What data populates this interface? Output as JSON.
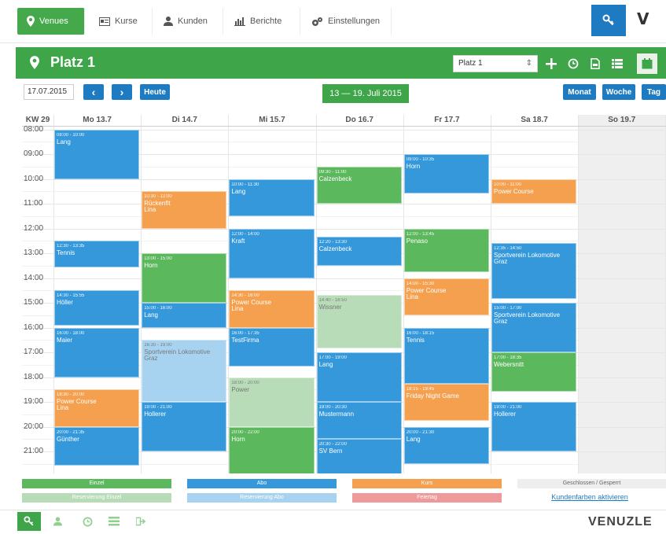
{
  "nav": {
    "tabs": [
      {
        "label": "Venues",
        "icon": "map-pin-icon"
      },
      {
        "label": "Kurse",
        "icon": "id-card-icon"
      },
      {
        "label": "Kunden",
        "icon": "person-icon"
      },
      {
        "label": "Berichte",
        "icon": "bar-chart-icon"
      },
      {
        "label": "Einstellungen",
        "icon": "gears-icon"
      }
    ],
    "logo_letter": "V"
  },
  "header": {
    "title": "Platz 1",
    "select_value": "Platz 1"
  },
  "toolbar": {
    "date_value": "17.07.2015",
    "prev": "‹",
    "next": "›",
    "today": "Heute",
    "range": "13 — 19. Juli 2015",
    "month": "Monat",
    "week": "Woche",
    "day": "Tag"
  },
  "calendar": {
    "week_label": "KW 29",
    "days": [
      "Mo 13.7",
      "Di 14.7",
      "Mi 15.7",
      "Do 16.7",
      "Fr 17.7",
      "Sa 18.7",
      "So 19.7"
    ],
    "hours": [
      "08:00",
      "09:00",
      "10:00",
      "11:00",
      "12:00",
      "13:00",
      "14:00",
      "15:00",
      "16:00",
      "17:00",
      "18:00",
      "19:00",
      "20:00",
      "21:00"
    ],
    "events": [
      {
        "day": 0,
        "start": 8.0,
        "end": 10.0,
        "time": "08:00 - 10:00",
        "name": "Lang",
        "type": "abo"
      },
      {
        "day": 0,
        "start": 12.5,
        "end": 13.58,
        "time": "12:30 - 13:35",
        "name": "Tennis",
        "type": "abo"
      },
      {
        "day": 0,
        "start": 14.5,
        "end": 15.92,
        "time": "14:30 - 15:55",
        "name": "Höller",
        "type": "abo"
      },
      {
        "day": 0,
        "start": 16.0,
        "end": 18.0,
        "time": "16:00 - 18:00",
        "name": "Maier",
        "type": "abo"
      },
      {
        "day": 0,
        "start": 18.5,
        "end": 20.0,
        "time": "18:30 - 20:00",
        "name": "Power Course",
        "sub": "Lina",
        "type": "kurs"
      },
      {
        "day": 0,
        "start": 20.0,
        "end": 21.58,
        "time": "20:00 - 21:35",
        "name": "Günther",
        "type": "abo"
      },
      {
        "day": 1,
        "start": 10.5,
        "end": 12.0,
        "time": "10:30 - 12:00",
        "name": "Rückenfit",
        "sub": "Lina",
        "type": "kurs"
      },
      {
        "day": 1,
        "start": 13.0,
        "end": 15.0,
        "time": "13:00 - 15:00",
        "name": "Horn",
        "type": "einzel"
      },
      {
        "day": 1,
        "start": 15.0,
        "end": 16.0,
        "time": "15:00 - 16:00",
        "name": "Lang",
        "type": "abo"
      },
      {
        "day": 1,
        "start": 16.5,
        "end": 19.0,
        "time": "16:30 - 19:00",
        "name": "Sportverein Lokomotive",
        "sub": "Graz",
        "type": "abo-res"
      },
      {
        "day": 1,
        "start": 19.0,
        "end": 21.0,
        "time": "19:00 - 21:00",
        "name": "Hollerer",
        "type": "abo"
      },
      {
        "day": 2,
        "start": 10.0,
        "end": 11.5,
        "time": "10:00 - 11:30",
        "name": "Lang",
        "type": "abo"
      },
      {
        "day": 2,
        "start": 12.0,
        "end": 14.0,
        "time": "12:00 - 14:00",
        "name": "Kraft",
        "type": "abo"
      },
      {
        "day": 2,
        "start": 14.5,
        "end": 16.0,
        "time": "14:30 - 16:00",
        "name": "Power Course",
        "sub": "Lina",
        "type": "kurs"
      },
      {
        "day": 2,
        "start": 16.0,
        "end": 17.58,
        "time": "16:00 - 17:35",
        "name": "TestFirma",
        "type": "abo"
      },
      {
        "day": 2,
        "start": 18.0,
        "end": 20.0,
        "time": "18:00 - 20:00",
        "name": "Power",
        "type": "einzel-res"
      },
      {
        "day": 2,
        "start": 20.0,
        "end": 22.0,
        "time": "20:00 - 22:00",
        "name": "Horn",
        "type": "einzel"
      },
      {
        "day": 3,
        "start": 9.5,
        "end": 11.0,
        "time": "09:30 - 11:00",
        "name": "Calzenbeck",
        "type": "einzel"
      },
      {
        "day": 3,
        "start": 12.33,
        "end": 13.5,
        "time": "12:20 - 13:30",
        "name": "Calzenbeck",
        "type": "abo"
      },
      {
        "day": 3,
        "start": 14.67,
        "end": 16.83,
        "time": "14:40 - 16:50",
        "name": "Wissner",
        "type": "einzel-res"
      },
      {
        "day": 3,
        "start": 17.0,
        "end": 19.0,
        "time": "17:00 - 19:00",
        "name": "Lang",
        "type": "abo"
      },
      {
        "day": 3,
        "start": 19.0,
        "end": 20.5,
        "time": "19:00 - 20:30",
        "name": "Mustermann",
        "type": "abo"
      },
      {
        "day": 3,
        "start": 20.5,
        "end": 22.0,
        "time": "20:30 - 22:00",
        "name": "SV Bern",
        "type": "abo"
      },
      {
        "day": 4,
        "start": 9.0,
        "end": 10.58,
        "time": "09:00 - 10:35",
        "name": "Horn",
        "type": "abo"
      },
      {
        "day": 4,
        "start": 12.0,
        "end": 13.75,
        "time": "12:00 - 13:45",
        "name": "Penaso",
        "type": "einzel"
      },
      {
        "day": 4,
        "start": 14.0,
        "end": 15.5,
        "time": "14:00 - 15:30",
        "name": "Power Course",
        "sub": "Lina",
        "type": "kurs"
      },
      {
        "day": 4,
        "start": 16.0,
        "end": 18.25,
        "time": "16:00 - 18:15",
        "name": "Tennis",
        "type": "abo"
      },
      {
        "day": 4,
        "start": 18.25,
        "end": 19.75,
        "time": "18:15 - 19:45",
        "name": "Friday Night Game",
        "type": "kurs"
      },
      {
        "day": 4,
        "start": 20.0,
        "end": 21.5,
        "time": "20:00 - 21:30",
        "name": "Lang",
        "type": "abo"
      },
      {
        "day": 5,
        "start": 10.0,
        "end": 11.0,
        "time": "10:00 - 11:00",
        "name": "Power Course",
        "type": "kurs"
      },
      {
        "day": 5,
        "start": 12.58,
        "end": 14.83,
        "time": "12:35 - 14:50",
        "name": "Sportverein Lokomotive",
        "sub": "Graz",
        "type": "abo"
      },
      {
        "day": 5,
        "start": 15.0,
        "end": 17.0,
        "time": "15:00 - 17:00",
        "name": "Sportverein Lokomotive",
        "sub": "Graz",
        "type": "abo"
      },
      {
        "day": 5,
        "start": 17.0,
        "end": 18.58,
        "time": "17:00 - 18:35",
        "name": "Webersnitt",
        "type": "einzel"
      },
      {
        "day": 5,
        "start": 19.0,
        "end": 21.0,
        "time": "19:00 - 21:00",
        "name": "Hollerer",
        "type": "abo"
      }
    ]
  },
  "legend": {
    "einzel": "Einzel",
    "abo": "Abo",
    "kurs": "Kurs",
    "closed": "Geschlossen / Gesperrt",
    "einzel_res": "Reservierung Einzel",
    "abo_res": "Reservierung Abo",
    "holiday": "Feiertag",
    "link": "Kundenfarben aktivieren"
  },
  "brand": "VENUZLE",
  "colors": {
    "green": "#3fa549",
    "blue": "#1e7bc1",
    "einzel": "#5cb85c",
    "abo": "#3498db",
    "kurs": "#f5a04f",
    "einzel_res": "#b8dcb8",
    "abo_res": "#a8d3f0",
    "holiday": "#ef9a9a",
    "closed": "#eeeeee"
  }
}
